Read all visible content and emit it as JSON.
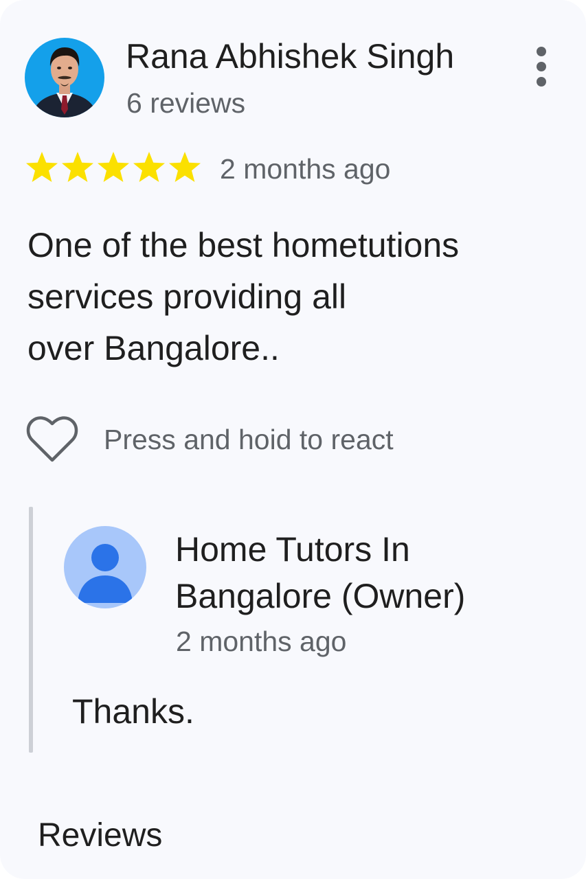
{
  "review": {
    "reviewer_name": "Rana Abhishek Singh",
    "review_count": "6 reviews",
    "rating": 5,
    "rating_max": 5,
    "time": "2 months ago",
    "text_lines": [
      "One of the best hometutions",
      "services providing all",
      "over Bangalore.."
    ],
    "react_label": "Press and hoid to react",
    "avatar_icon": "profile-photo",
    "menu_icon": "more-vert-icon"
  },
  "owner_reply": {
    "name_lines": [
      "Home Tutors In",
      "Bangalore (Owner)"
    ],
    "time": "2 months ago",
    "text": "Thanks.",
    "avatar_icon": "person-icon"
  },
  "section_title": "Reviews",
  "colors": {
    "star": "#fbe000",
    "text_primary": "#1f1f1f",
    "text_secondary": "#5f6368",
    "avatar_bg": "#a8c7fa",
    "avatar_person": "#2b73e8",
    "photo_bg": "#14a0ea",
    "card_bg": "#f8f9fd",
    "reply_bar": "#cdd0d6"
  }
}
